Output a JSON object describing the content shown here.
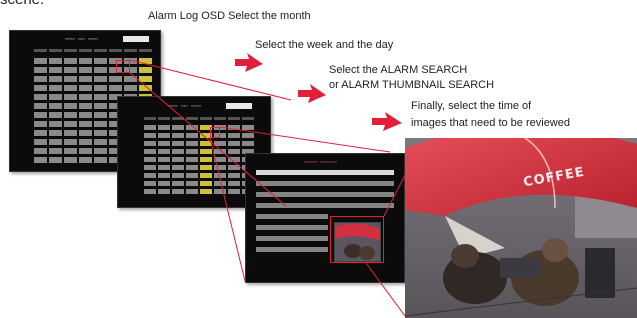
{
  "top_cut_text": "scene.",
  "captions": [
    "Alarm  Log OSD Select the month",
    "Select the week and the day",
    "Select the ALARM SEARCH",
    "or ALARM THUMBNAIL SEARCH",
    "Finally, select the time of",
    "images that need to be reviewed"
  ],
  "photo_sign_text": "COFFEE",
  "colors": {
    "arrow": "#e0203a",
    "highlight": "#e0203a",
    "screen": "#0b0b0b"
  },
  "icons": {
    "arrow": "red-arrow-icon"
  }
}
